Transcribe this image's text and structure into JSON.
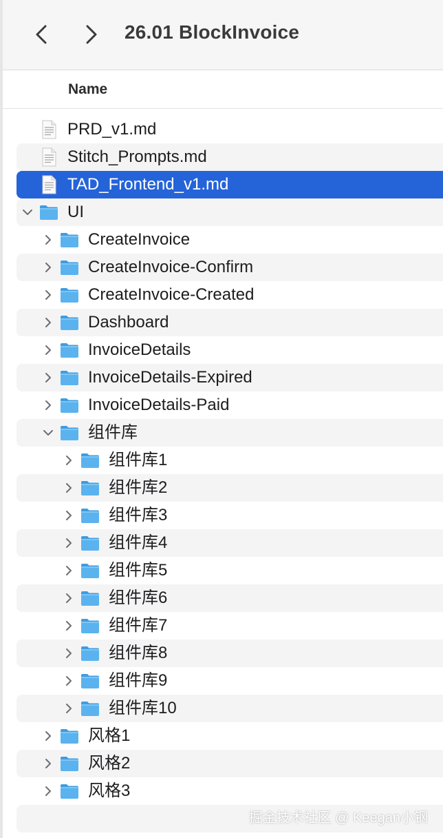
{
  "window": {
    "title": "26.01 BlockInvoice"
  },
  "toolbar": {
    "back_icon": "chevron-left-icon",
    "forward_icon": "chevron-right-icon"
  },
  "columns": {
    "name": "Name"
  },
  "colors": {
    "selection": "#2563d8",
    "folder": "#5ab3ee",
    "stripe": "#f4f4f5"
  },
  "items": [
    {
      "label": "PRD_v1.md",
      "type": "file",
      "depth": 0,
      "disclosure": "none",
      "selected": false
    },
    {
      "label": "Stitch_Prompts.md",
      "type": "file",
      "depth": 0,
      "disclosure": "none",
      "selected": false
    },
    {
      "label": "TAD_Frontend_v1.md",
      "type": "file",
      "depth": 0,
      "disclosure": "none",
      "selected": true
    },
    {
      "label": "UI",
      "type": "folder",
      "depth": 0,
      "disclosure": "expanded",
      "selected": false
    },
    {
      "label": "CreateInvoice",
      "type": "folder",
      "depth": 1,
      "disclosure": "collapsed",
      "selected": false
    },
    {
      "label": "CreateInvoice-Confirm",
      "type": "folder",
      "depth": 1,
      "disclosure": "collapsed",
      "selected": false
    },
    {
      "label": "CreateInvoice-Created",
      "type": "folder",
      "depth": 1,
      "disclosure": "collapsed",
      "selected": false
    },
    {
      "label": "Dashboard",
      "type": "folder",
      "depth": 1,
      "disclosure": "collapsed",
      "selected": false
    },
    {
      "label": "InvoiceDetails",
      "type": "folder",
      "depth": 1,
      "disclosure": "collapsed",
      "selected": false
    },
    {
      "label": "InvoiceDetails-Expired",
      "type": "folder",
      "depth": 1,
      "disclosure": "collapsed",
      "selected": false
    },
    {
      "label": "InvoiceDetails-Paid",
      "type": "folder",
      "depth": 1,
      "disclosure": "collapsed",
      "selected": false
    },
    {
      "label": "组件库",
      "type": "folder",
      "depth": 1,
      "disclosure": "expanded",
      "selected": false
    },
    {
      "label": "组件库1",
      "type": "folder",
      "depth": 2,
      "disclosure": "collapsed",
      "selected": false
    },
    {
      "label": "组件库2",
      "type": "folder",
      "depth": 2,
      "disclosure": "collapsed",
      "selected": false
    },
    {
      "label": "组件库3",
      "type": "folder",
      "depth": 2,
      "disclosure": "collapsed",
      "selected": false
    },
    {
      "label": "组件库4",
      "type": "folder",
      "depth": 2,
      "disclosure": "collapsed",
      "selected": false
    },
    {
      "label": "组件库5",
      "type": "folder",
      "depth": 2,
      "disclosure": "collapsed",
      "selected": false
    },
    {
      "label": "组件库6",
      "type": "folder",
      "depth": 2,
      "disclosure": "collapsed",
      "selected": false
    },
    {
      "label": "组件库7",
      "type": "folder",
      "depth": 2,
      "disclosure": "collapsed",
      "selected": false
    },
    {
      "label": "组件库8",
      "type": "folder",
      "depth": 2,
      "disclosure": "collapsed",
      "selected": false
    },
    {
      "label": "组件库9",
      "type": "folder",
      "depth": 2,
      "disclosure": "collapsed",
      "selected": false
    },
    {
      "label": "组件库10",
      "type": "folder",
      "depth": 2,
      "disclosure": "collapsed",
      "selected": false
    },
    {
      "label": "风格1",
      "type": "folder",
      "depth": 1,
      "disclosure": "collapsed",
      "selected": false
    },
    {
      "label": "风格2",
      "type": "folder",
      "depth": 1,
      "disclosure": "collapsed",
      "selected": false
    },
    {
      "label": "风格3",
      "type": "folder",
      "depth": 1,
      "disclosure": "collapsed",
      "selected": false
    }
  ],
  "watermark": "掘金技术社区 @ Keegan小钢"
}
